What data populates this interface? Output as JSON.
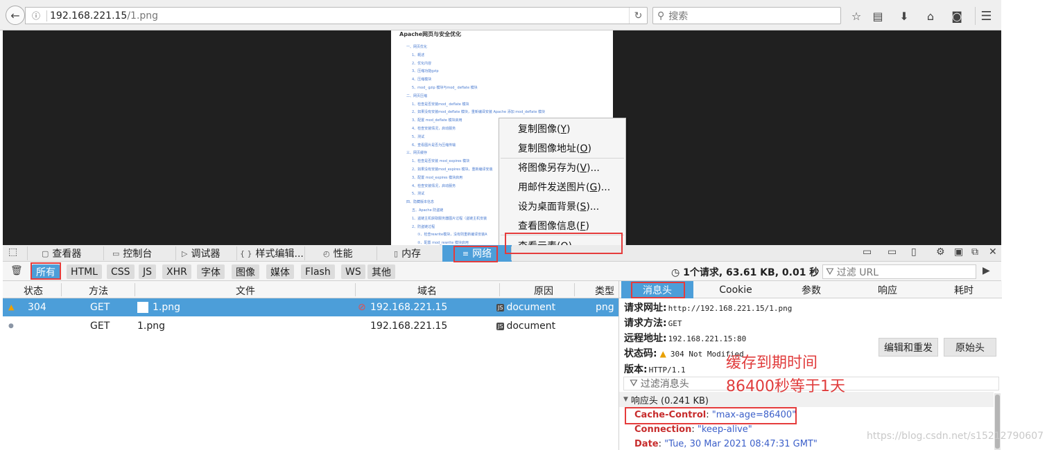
{
  "browser": {
    "url_host": "192.168.221.15",
    "url_path": "/1.png",
    "search_placeholder": "搜索"
  },
  "doc": {
    "title": "Apache网页与安全优化",
    "lines": [
      "一、网页优化",
      "1、概述",
      "2、优化内容",
      "3、压缩功能gzip",
      "4、压缩模块",
      "5、mod_ gzip 模块与mod_ deflate 模块",
      "二、网页压缩",
      "1、检查是否安装mod_ deflate 模块",
      "2、如果没有安装mod_deflate 模块，重新编译安装 Apache 添加 mod_deflate 模块",
      "3、配置 mod_deflate 模块启用",
      "4、检查安装情况，启动服务",
      "5、测试",
      "6、查看图片是否为压缩传输",
      "三、网页缓存",
      "1、检查是否安装 mod_expires 模块",
      "2、如果没有安装mod_expires 模块，重新编译安装",
      "3、配置 mod_expires 模块启用",
      "4、检查安装情况，启动服务",
      "5、测试",
      "四、隐藏版本信息",
      "五、Apache 防盗链",
      "1、盗链主机获取服务器图片过程（盗链主机安装",
      "2、防盗链过程",
      "①、检查rewrite模块，没有则重新编译安装A",
      "②、配置 mod_rewrite 模块启用"
    ]
  },
  "context_menu": [
    {
      "label": "复制图像(",
      "key": "Y",
      "end": ")"
    },
    {
      "label": "复制图像地址(",
      "key": "O",
      "end": ")"
    },
    {
      "label": "将图像另存为(",
      "key": "V",
      "end": ")..."
    },
    {
      "label": "用邮件发送图片(",
      "key": "G",
      "end": ")..."
    },
    {
      "label": "设为桌面背景(",
      "key": "S",
      "end": ")..."
    },
    {
      "label": "查看图像信息(",
      "key": "F",
      "end": ")"
    },
    {
      "label": "查看元素(",
      "key": "Q",
      "end": ")"
    }
  ],
  "devtools": {
    "tabs": [
      "查看器",
      "控制台",
      "调试器",
      "样式编辑...",
      "性能",
      "内存",
      "网络"
    ],
    "tab_icons": [
      "▢",
      "▭",
      "▷",
      "{ }",
      "◴",
      "▯",
      "≡"
    ],
    "filters": [
      "所有",
      "HTML",
      "CSS",
      "JS",
      "XHR",
      "字体",
      "图像",
      "媒体",
      "Flash",
      "WS",
      "其他"
    ],
    "summary": "1个请求, 63.61 KB, 0.01 秒",
    "url_filter_placeholder": "过滤 URL"
  },
  "requests": {
    "columns": [
      "状态",
      "方法",
      "文件",
      "域名",
      "原因",
      "类型"
    ],
    "rows": [
      {
        "status": "304",
        "method": "GET",
        "file": "1.png",
        "domain": "192.168.221.15",
        "cause": "document",
        "type": "png",
        "badge": "JS"
      },
      {
        "status": "",
        "method": "GET",
        "file": "1.png",
        "domain": "192.168.221.15",
        "cause": "document",
        "type": "",
        "badge": "JS"
      }
    ]
  },
  "details": {
    "tabs": [
      "消息头",
      "Cookie",
      "参数",
      "响应",
      "耗时"
    ],
    "request_url_label": "请求网址:",
    "request_url": "http://192.168.221.15/1.png",
    "method_label": "请求方法:",
    "method": "GET",
    "remote_label": "远程地址:",
    "remote": "192.168.221.15:80",
    "status_label": "状态码:",
    "status": "304 Not Modified",
    "version_label": "版本:",
    "version": "HTTP/1.1",
    "edit_resend": "编辑和重发",
    "raw_headers": "原始头",
    "filter_headers": "过滤消息头",
    "response_headers": "响应头 (0.241 KB)",
    "headers": [
      {
        "key": "Cache-Control",
        "value": "\"max-age=86400\""
      },
      {
        "key": "Connection",
        "value": "\"keep-alive\""
      },
      {
        "key": "Date",
        "value": "\"Tue, 30 Mar 2021 08:47:31 GMT\""
      }
    ]
  },
  "annotation": {
    "line1": "缓存到期时间",
    "line2": "86400秒等于1天"
  },
  "watermark": "https://blog.csdn.net/s15212790607",
  "colors": {
    "accent": "#4c9ed9",
    "annotation": "#e53b3b"
  }
}
